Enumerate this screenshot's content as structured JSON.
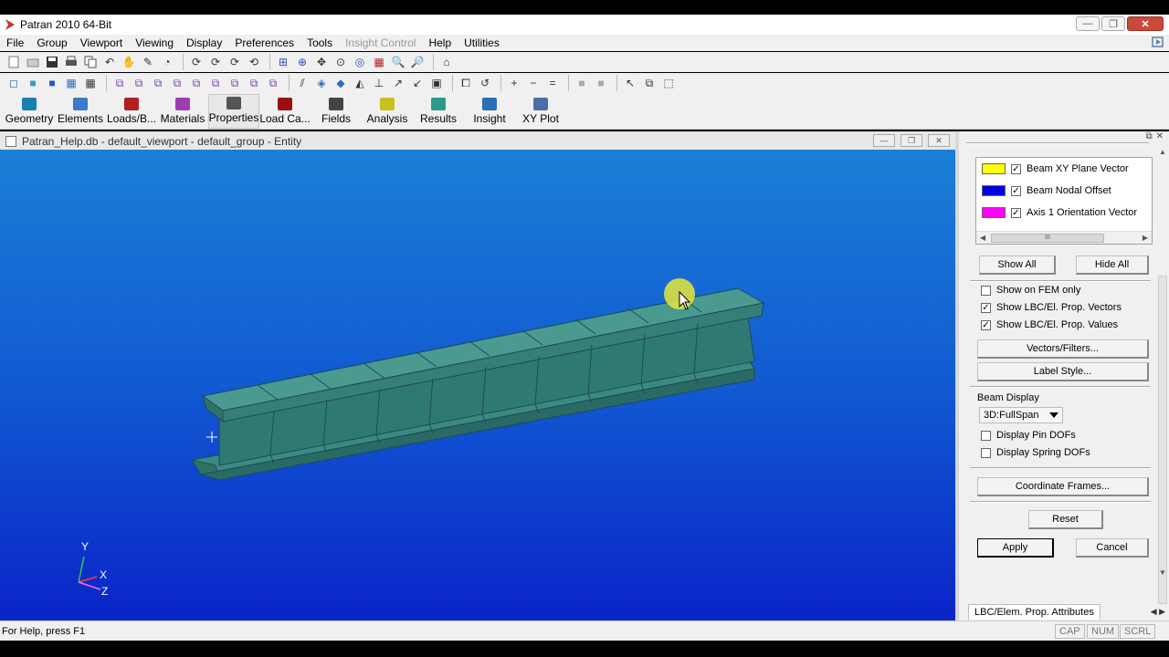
{
  "window": {
    "title": "Patran 2010 64-Bit",
    "minimize": "▭",
    "restore": "❐",
    "close": "✕"
  },
  "menu": [
    "File",
    "Group",
    "Viewport",
    "Viewing",
    "Display",
    "Preferences",
    "Tools",
    "Insight Control",
    "Help",
    "Utilities"
  ],
  "menu_disabled_index": 7,
  "apps": [
    {
      "label": "Geometry",
      "color": "#1a7fb5"
    },
    {
      "label": "Elements",
      "color": "#3a7acc"
    },
    {
      "label": "Loads/B...",
      "color": "#b02020"
    },
    {
      "label": "Materials",
      "color": "#9b3fb0"
    },
    {
      "label": "Properties",
      "color": "#555555"
    },
    {
      "label": "Load Ca...",
      "color": "#9a1010"
    },
    {
      "label": "Fields",
      "color": "#444444"
    },
    {
      "label": "Analysis",
      "color": "#c9c020"
    },
    {
      "label": "Results",
      "color": "#2c9a8a"
    },
    {
      "label": "Insight",
      "color": "#2a6fb8"
    },
    {
      "label": "XY Plot",
      "color": "#4a6fa8"
    }
  ],
  "viewport": {
    "title": "Patran_Help.db - default_viewport - default_group - Entity",
    "axes": {
      "y": "Y",
      "x": "X",
      "z": "Z"
    }
  },
  "panel": {
    "list": [
      {
        "label": "Beam XY Plane Vector",
        "color": "#ffff00",
        "checked": true
      },
      {
        "label": "Beam Nodal Offset",
        "color": "#0000e0",
        "checked": true
      },
      {
        "label": "Axis 1 Orientation Vector",
        "color": "#ff00ff",
        "checked": true
      }
    ],
    "show_all": "Show All",
    "hide_all": "Hide All",
    "show_fem_only": "Show on FEM only",
    "show_vectors": "Show LBC/El. Prop. Vectors",
    "show_values": "Show LBC/El. Prop. Values",
    "vectors_filters": "Vectors/Filters...",
    "label_style": "Label Style...",
    "beam_display_label": "Beam Display",
    "beam_display_value": "3D:FullSpan",
    "pin_dofs": "Display Pin DOFs",
    "spring_dofs": "Display Spring DOFs",
    "coordinate_frames": "Coordinate Frames...",
    "reset": "Reset",
    "apply": "Apply",
    "cancel": "Cancel",
    "tab": "LBC/Elem. Prop. Attributes"
  },
  "status": {
    "help": "For Help, press F1",
    "cap": "CAP",
    "num": "NUM",
    "scrl": "SCRL"
  }
}
